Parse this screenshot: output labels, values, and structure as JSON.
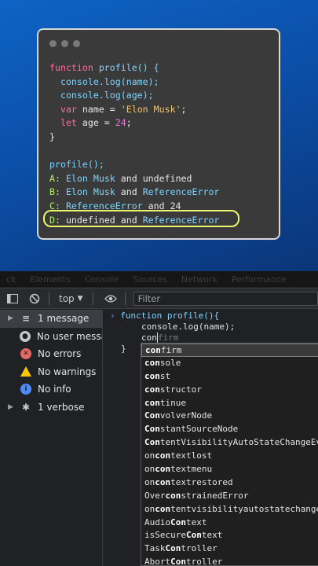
{
  "quiz": {
    "code_lines": [
      {
        "parts": [
          {
            "t": "function ",
            "c": "kw"
          },
          {
            "t": "profile() {",
            "c": "fn"
          }
        ]
      },
      {
        "parts": [
          {
            "t": "  console.log(name);",
            "c": "fn"
          }
        ]
      },
      {
        "parts": [
          {
            "t": "  console.log(age);",
            "c": "fn"
          }
        ]
      },
      {
        "parts": [
          {
            "t": "  var ",
            "c": "kw"
          },
          {
            "t": "name = ",
            "c": ""
          },
          {
            "t": "'Elon Musk'",
            "c": "str"
          },
          {
            "t": ";",
            "c": ""
          }
        ]
      },
      {
        "parts": [
          {
            "t": "  let ",
            "c": "kw"
          },
          {
            "t": "age = ",
            "c": ""
          },
          {
            "t": "24",
            "c": "num"
          },
          {
            "t": ";",
            "c": ""
          }
        ]
      },
      {
        "parts": [
          {
            "t": "}",
            "c": ""
          }
        ]
      },
      {
        "parts": [
          {
            "t": "",
            "c": ""
          }
        ]
      },
      {
        "parts": [
          {
            "t": "profile();",
            "c": "fn"
          }
        ]
      },
      {
        "parts": [
          {
            "t": "A: ",
            "c": "grn"
          },
          {
            "t": "Elon Musk ",
            "c": "fn"
          },
          {
            "t": "and ",
            "c": ""
          },
          {
            "t": "undefined",
            "c": ""
          }
        ]
      },
      {
        "parts": [
          {
            "t": "B: ",
            "c": "grn"
          },
          {
            "t": "Elon Musk ",
            "c": "fn"
          },
          {
            "t": "and ",
            "c": ""
          },
          {
            "t": "ReferenceError",
            "c": "fn"
          }
        ]
      },
      {
        "parts": [
          {
            "t": "C: ",
            "c": "grn"
          },
          {
            "t": "ReferenceError ",
            "c": "fn"
          },
          {
            "t": "and ",
            "c": ""
          },
          {
            "t": "24",
            "c": ""
          }
        ]
      },
      {
        "parts": [
          {
            "t": "D: ",
            "c": "grn"
          },
          {
            "t": "undefined ",
            "c": ""
          },
          {
            "t": "and ",
            "c": ""
          },
          {
            "t": "ReferenceError",
            "c": "fn"
          }
        ]
      }
    ]
  },
  "devtools": {
    "tabs": [
      "ck",
      "Elements",
      "Console",
      "Sources",
      "Network",
      "Performance"
    ],
    "context": "top",
    "filter_placeholder": "Filter",
    "sidebar": [
      {
        "label": "1 message",
        "icon": "list-icon",
        "color": "#c4c7c5",
        "caret": true,
        "selected": true
      },
      {
        "label": "No user messa...",
        "icon": "user-icon",
        "color": "#c4c7c5",
        "caret": false,
        "selected": false
      },
      {
        "label": "No errors",
        "icon": "error-icon",
        "color": "#e46962",
        "caret": false,
        "selected": false
      },
      {
        "label": "No warnings",
        "icon": "warning-icon",
        "color": "#f9c800",
        "caret": false,
        "selected": false
      },
      {
        "label": "No info",
        "icon": "info-icon",
        "color": "#4f8cf7",
        "caret": false,
        "selected": false
      },
      {
        "label": "1 verbose",
        "icon": "bug-icon",
        "color": "#c4c7c5",
        "caret": true,
        "selected": false
      }
    ],
    "console_lines": [
      "function profile(){",
      "console.log(name);",
      "con",
      "}"
    ],
    "ghost_text": "firm",
    "autocomplete": [
      {
        "pre": "",
        "match": "con",
        "post": "firm"
      },
      {
        "pre": "",
        "match": "con",
        "post": "sole"
      },
      {
        "pre": "",
        "match": "con",
        "post": "st"
      },
      {
        "pre": "",
        "match": "con",
        "post": "structor"
      },
      {
        "pre": "",
        "match": "con",
        "post": "tinue"
      },
      {
        "pre": "",
        "match": "Con",
        "post": "volverNode"
      },
      {
        "pre": "",
        "match": "Con",
        "post": "stantSourceNode"
      },
      {
        "pre": "",
        "match": "Con",
        "post": "tentVisibilityAutoStateChangeEvent"
      },
      {
        "pre": "on",
        "match": "con",
        "post": "textlost"
      },
      {
        "pre": "on",
        "match": "con",
        "post": "textmenu"
      },
      {
        "pre": "on",
        "match": "con",
        "post": "textrestored"
      },
      {
        "pre": "Over",
        "match": "con",
        "post": "strainedError"
      },
      {
        "pre": "on",
        "match": "con",
        "post": "tentvisibilityautostatechange"
      },
      {
        "pre": "Audio",
        "match": "Con",
        "post": "text"
      },
      {
        "pre": "isSecure",
        "match": "Con",
        "post": "text"
      },
      {
        "pre": "Task",
        "match": "Con",
        "post": "troller"
      },
      {
        "pre": "Abort",
        "match": "Con",
        "post": "troller"
      }
    ]
  }
}
